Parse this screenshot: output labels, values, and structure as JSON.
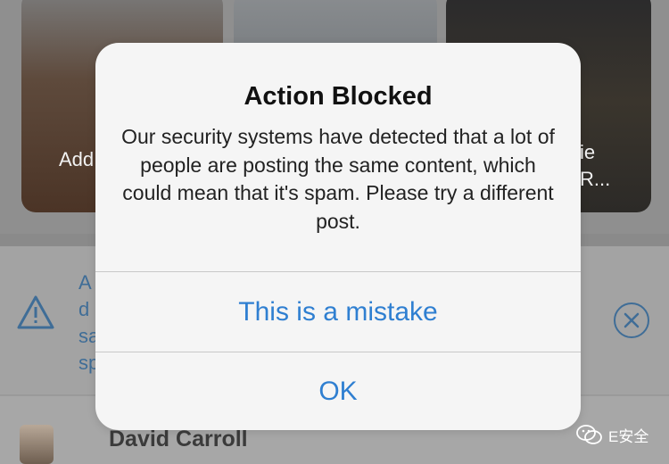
{
  "dialog": {
    "title": "Action Blocked",
    "message": "Our security systems have detected that a lot of people are posting the same content, which could mean that it's spam. Please try a different post.",
    "buttons": {
      "mistake": "This is a mistake",
      "ok": "OK"
    }
  },
  "background": {
    "cards": [
      {
        "text": "Add"
      },
      {
        "text": ""
      },
      {
        "line1": "ie",
        "line2": "R..."
      }
    ],
    "banner": {
      "lines": [
        "A",
        "d",
        "sa",
        "sp"
      ],
      "warning_icon": "warning-triangle-icon",
      "close_icon": "close-circle-icon"
    },
    "post": {
      "author": "David Carroll"
    }
  },
  "watermark": {
    "text": "E安全",
    "logo_icon": "wechat-logo-icon"
  },
  "colors": {
    "accent_blue": "#2f7fd1",
    "dialog_bg": "#f5f5f5",
    "dim_blue": "#3f6d97"
  }
}
